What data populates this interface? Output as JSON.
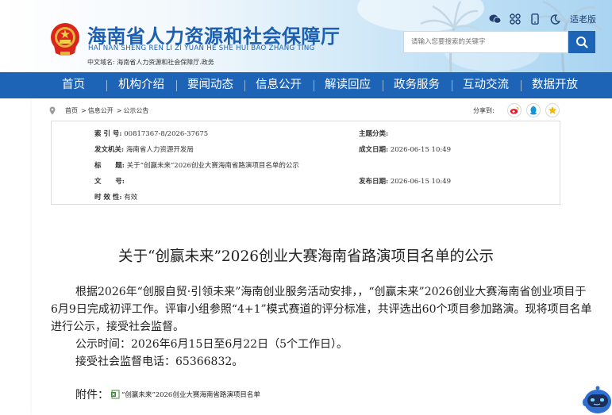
{
  "header": {
    "title": "海南省人力资源和社会保障厅",
    "pinyin": "HAI NAN SHENG REN LI ZI YUAN HE SHE HUI BAO ZHANG TING",
    "domain_label": "中文域名:",
    "domain_value": "海南省人力资源和社会保障厅.政务",
    "elder_mode": "适老版",
    "search_placeholder": "请输入您要搜索的关键字"
  },
  "nav": {
    "items": [
      "首页",
      "机构介绍",
      "要闻动态",
      "信息公开",
      "解读回应",
      "政务服务",
      "互动交流",
      "数据开放"
    ]
  },
  "breadcrumb": {
    "home": "首页",
    "level1": "信息公开",
    "level2": "公示公告",
    "sep": ">"
  },
  "share": {
    "label": "分享到:"
  },
  "meta": {
    "index_label": "索 引 号:",
    "index_value": "00817367-8/2026-37675",
    "category_label": "主题分类:",
    "category_value": "",
    "issuer_label": "发文机关:",
    "issuer_value": "海南省人力资源开发局",
    "created_label": "成文日期:",
    "created_value": "2026-06-15 10:49",
    "title_label": "标      题:",
    "title_value": "关于“创赢未来”2026创业大赛海南省路演项目名单的公示",
    "docno_label": "文      号:",
    "docno_value": "",
    "published_label": "发布日期:",
    "published_value": "2026-06-15 10:49",
    "validity_label": "时 效 性:",
    "validity_value": "有效"
  },
  "article": {
    "title": "关于“创赢未来”2026创业大赛海南省路演项目名单的公示",
    "lines": [
      "根据2026年“创服自贸·引领未来”海南创业服务活动安排，，“创赢未来”2026创业大赛海南省创业项目于",
      "6月9日完成初评工作。评审小组参照“4+1”模式赛道的评分标准，共评选出60个项目参加路演。现将项目名单",
      "进行公示，接受社会监督。",
      "公示时间：2026年6月15日至6月22日（5个工作日）。",
      "接受社会监督电话：65366832。"
    ],
    "attachment_label": "附件：",
    "attachment_file": "“创赢未来”2026创业大赛海南省路演项目名单"
  },
  "colors": {
    "brand_blue": "#1e64b6",
    "title_blue": "#1d5fb0"
  }
}
